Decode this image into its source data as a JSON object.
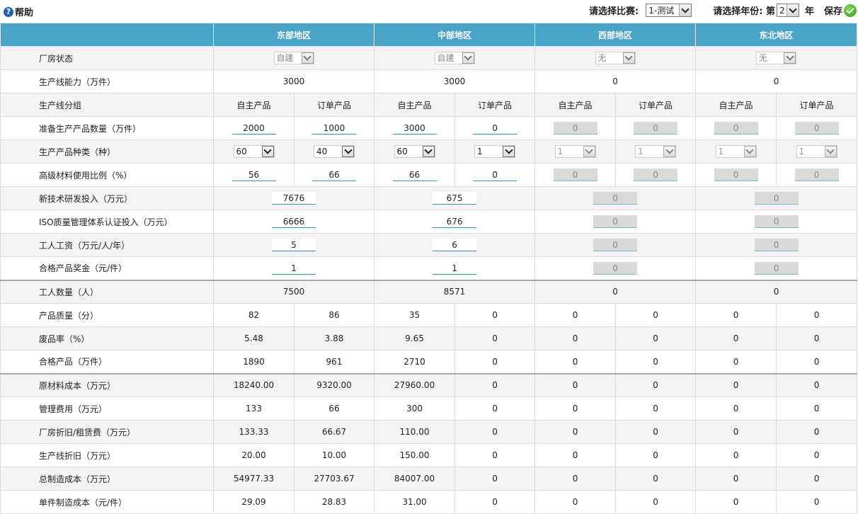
{
  "help": {
    "icon": "help-icon",
    "label": "帮助"
  },
  "toolbar": {
    "match_label": "请选择比赛:",
    "match_value": "1-测试",
    "year_label": "请选择年份: 第",
    "year_value": "2",
    "year_suffix": "年",
    "save_label": "保存",
    "save_icon": "check-circle-icon"
  },
  "regions": [
    "东部地区",
    "中部地区",
    "西部地区",
    "东北地区"
  ],
  "factory": {
    "label": "厂房状态",
    "values": [
      "自建",
      "自建",
      "无",
      "无"
    ]
  },
  "capacity": {
    "label": "生产线能力（万件）",
    "values": [
      "3000",
      "3000",
      "0",
      "0"
    ]
  },
  "grouping": {
    "label": "生产线分组",
    "values": [
      "自主产品",
      "订单产品",
      "自主产品",
      "订单产品",
      "自主产品",
      "订单产品",
      "自主产品",
      "订单产品"
    ]
  },
  "prep_qty": {
    "label": "准备生产产品数量（万件）",
    "values": [
      "2000",
      "1000",
      "3000",
      "0",
      "0",
      "0",
      "0",
      "0"
    ]
  },
  "variety": {
    "label": "生产产品种类（种）",
    "values": [
      "60",
      "40",
      "60",
      "1",
      "1",
      "1",
      "1",
      "1"
    ]
  },
  "material_ratio": {
    "label": "高级材料使用比例（%）",
    "values": [
      "56",
      "66",
      "66",
      "0",
      "0",
      "0",
      "0",
      "0"
    ]
  },
  "rd": {
    "label": "新技术研发投入（万元）",
    "values": [
      "7676",
      "675",
      "0",
      "0"
    ]
  },
  "iso": {
    "label": "ISO质量管理体系认证投入（万元）",
    "values": [
      "6666",
      "676",
      "0",
      "0"
    ]
  },
  "wage": {
    "label": "工人工资（万元/人/年）",
    "values": [
      "5",
      "6",
      "0",
      "0"
    ]
  },
  "bonus": {
    "label": "合格产品奖金（元/件）",
    "values": [
      "1",
      "1",
      "0",
      "0"
    ]
  },
  "workers": {
    "label": "工人数量（人）",
    "values": [
      "7500",
      "8571",
      "0",
      "0"
    ]
  },
  "quality": {
    "label": "产品质量（分）",
    "values": [
      "82",
      "86",
      "35",
      "0",
      "0",
      "0",
      "0",
      "0"
    ]
  },
  "scrap": {
    "label": "废品率（%）",
    "values": [
      "5.48",
      "3.88",
      "9.65",
      "0",
      "0",
      "0",
      "0",
      "0"
    ]
  },
  "qualified": {
    "label": "合格产品（万件）",
    "values": [
      "1890",
      "961",
      "2710",
      "0",
      "0",
      "0",
      "0",
      "0"
    ]
  },
  "raw_cost": {
    "label": "原材料成本（万元）",
    "values": [
      "18240.00",
      "9320.00",
      "27960.00",
      "0",
      "0",
      "0",
      "0",
      "0"
    ]
  },
  "mgmt": {
    "label": "管理费用（万元）",
    "values": [
      "133",
      "66",
      "300",
      "0",
      "0",
      "0",
      "0",
      "0"
    ]
  },
  "depr": {
    "label": "厂房折旧/租赁费（万元）",
    "values": [
      "133.33",
      "66.67",
      "110.00",
      "0",
      "0",
      "0",
      "0",
      "0"
    ]
  },
  "line_depr": {
    "label": "生产线折旧（万元）",
    "values": [
      "20.00",
      "10.00",
      "150.00",
      "0",
      "0",
      "0",
      "0",
      "0"
    ]
  },
  "total_cost": {
    "label": "总制造成本（万元）",
    "values": [
      "54977.33",
      "27703.67",
      "84007.00",
      "0",
      "0",
      "0",
      "0",
      "0"
    ]
  },
  "unit_cost": {
    "label": "单件制造成本（元/件）",
    "values": [
      "29.09",
      "28.83",
      "31.00",
      "0",
      "0",
      "0",
      "0",
      "0"
    ]
  }
}
